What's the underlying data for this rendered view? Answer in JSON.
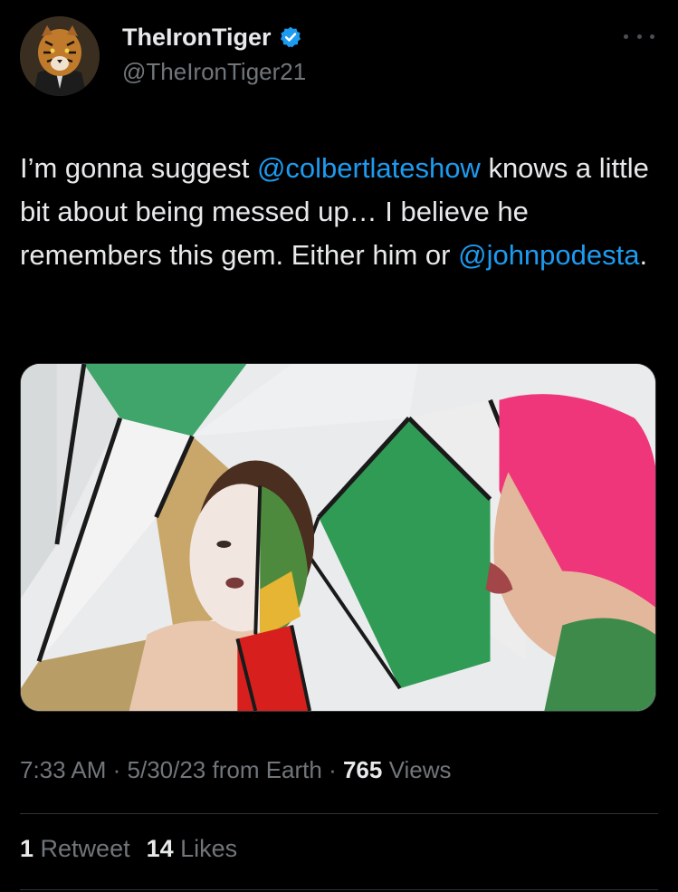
{
  "author": {
    "display_name": "TheIronTiger",
    "handle": "@TheIronTiger21",
    "avatar_icon": "tiger-avatar-icon",
    "verified_icon": "verified-badge-icon",
    "verified_color": "#1d9bf0"
  },
  "more_icon": "more-options-icon",
  "tweet": {
    "line1_text": "I’m gonna suggest ",
    "mention1": "@colbertlateshow",
    "line2_text": " knows a little bit about being messed up… I believe he remembers this gem. Either him or ",
    "mention2": "@johnpodesta",
    "end_text": "."
  },
  "meta": {
    "time": "7:33 AM",
    "separator1": " · ",
    "date": "5/30/23",
    "source": " from Earth",
    "separator2": " · ",
    "views_count": "765",
    "views_label": " Views"
  },
  "stats": {
    "retweets_count": "1",
    "retweets_label": " Retweet",
    "likes_count": "14",
    "likes_label": " Likes"
  },
  "colors": {
    "background": "#000000",
    "text_primary": "#e7e9ea",
    "text_secondary": "#71767b",
    "link": "#1d9bf0",
    "divider": "#2f3336"
  }
}
